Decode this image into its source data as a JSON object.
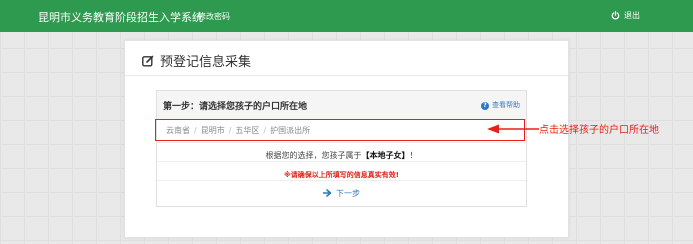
{
  "header": {
    "title": "昆明市义务教育阶段招生入学系统",
    "change_password": "修改密码",
    "logout": "退出"
  },
  "card": {
    "title": "预登记信息采集"
  },
  "step": {
    "title": "第一步：请选择您孩子的户口所在地",
    "help": "查看帮助"
  },
  "address": {
    "crumbs": [
      "云南省",
      "昆明市",
      "五华区",
      "护国派出所"
    ]
  },
  "result": {
    "prefix": "根据您的选择，您孩子属于",
    "value": "【本地子女】",
    "suffix": "！"
  },
  "warning": "※请确保以上所填写的信息真实有效!",
  "next_button": "下一步",
  "annotation": {
    "text": "点击选择孩子的户口所在地",
    "color": "#e62117"
  },
  "colors": {
    "topbar": "#2e9a4f",
    "link": "#2f77c2",
    "warning": "#e0201b"
  }
}
